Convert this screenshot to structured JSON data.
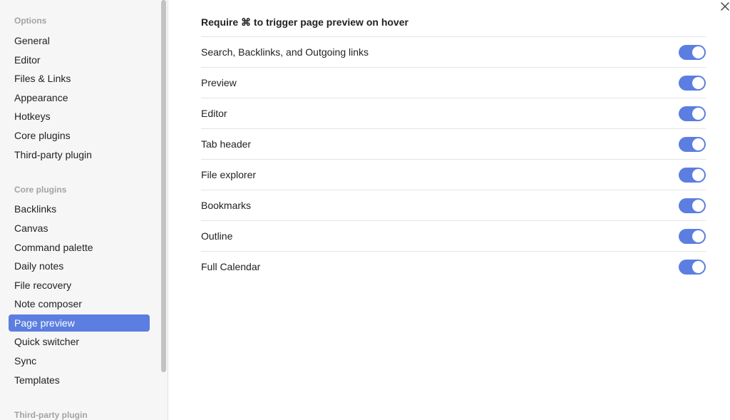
{
  "sidebar": {
    "options_title": "Options",
    "options_items": [
      "General",
      "Editor",
      "Files & Links",
      "Appearance",
      "Hotkeys",
      "Core plugins",
      "Third-party plugin"
    ],
    "core_title": "Core plugins",
    "core_items": [
      "Backlinks",
      "Canvas",
      "Command palette",
      "Daily notes",
      "File recovery",
      "Note composer",
      "Page preview",
      "Quick switcher",
      "Sync",
      "Templates"
    ],
    "active_item": "Page preview",
    "third_party_title": "Third-party plugin"
  },
  "main": {
    "heading": "Require ⌘ to trigger page preview on hover",
    "settings": [
      {
        "label": "Search, Backlinks, and Outgoing links",
        "enabled": true
      },
      {
        "label": "Preview",
        "enabled": true
      },
      {
        "label": "Editor",
        "enabled": true
      },
      {
        "label": "Tab header",
        "enabled": true
      },
      {
        "label": "File explorer",
        "enabled": true
      },
      {
        "label": "Bookmarks",
        "enabled": true
      },
      {
        "label": "Outline",
        "enabled": true
      },
      {
        "label": "Full Calendar",
        "enabled": true
      }
    ]
  },
  "colors": {
    "accent": "#5b7ee0",
    "sidebar_bg": "#f6f6f6"
  },
  "icons": {
    "close": "close-icon"
  }
}
